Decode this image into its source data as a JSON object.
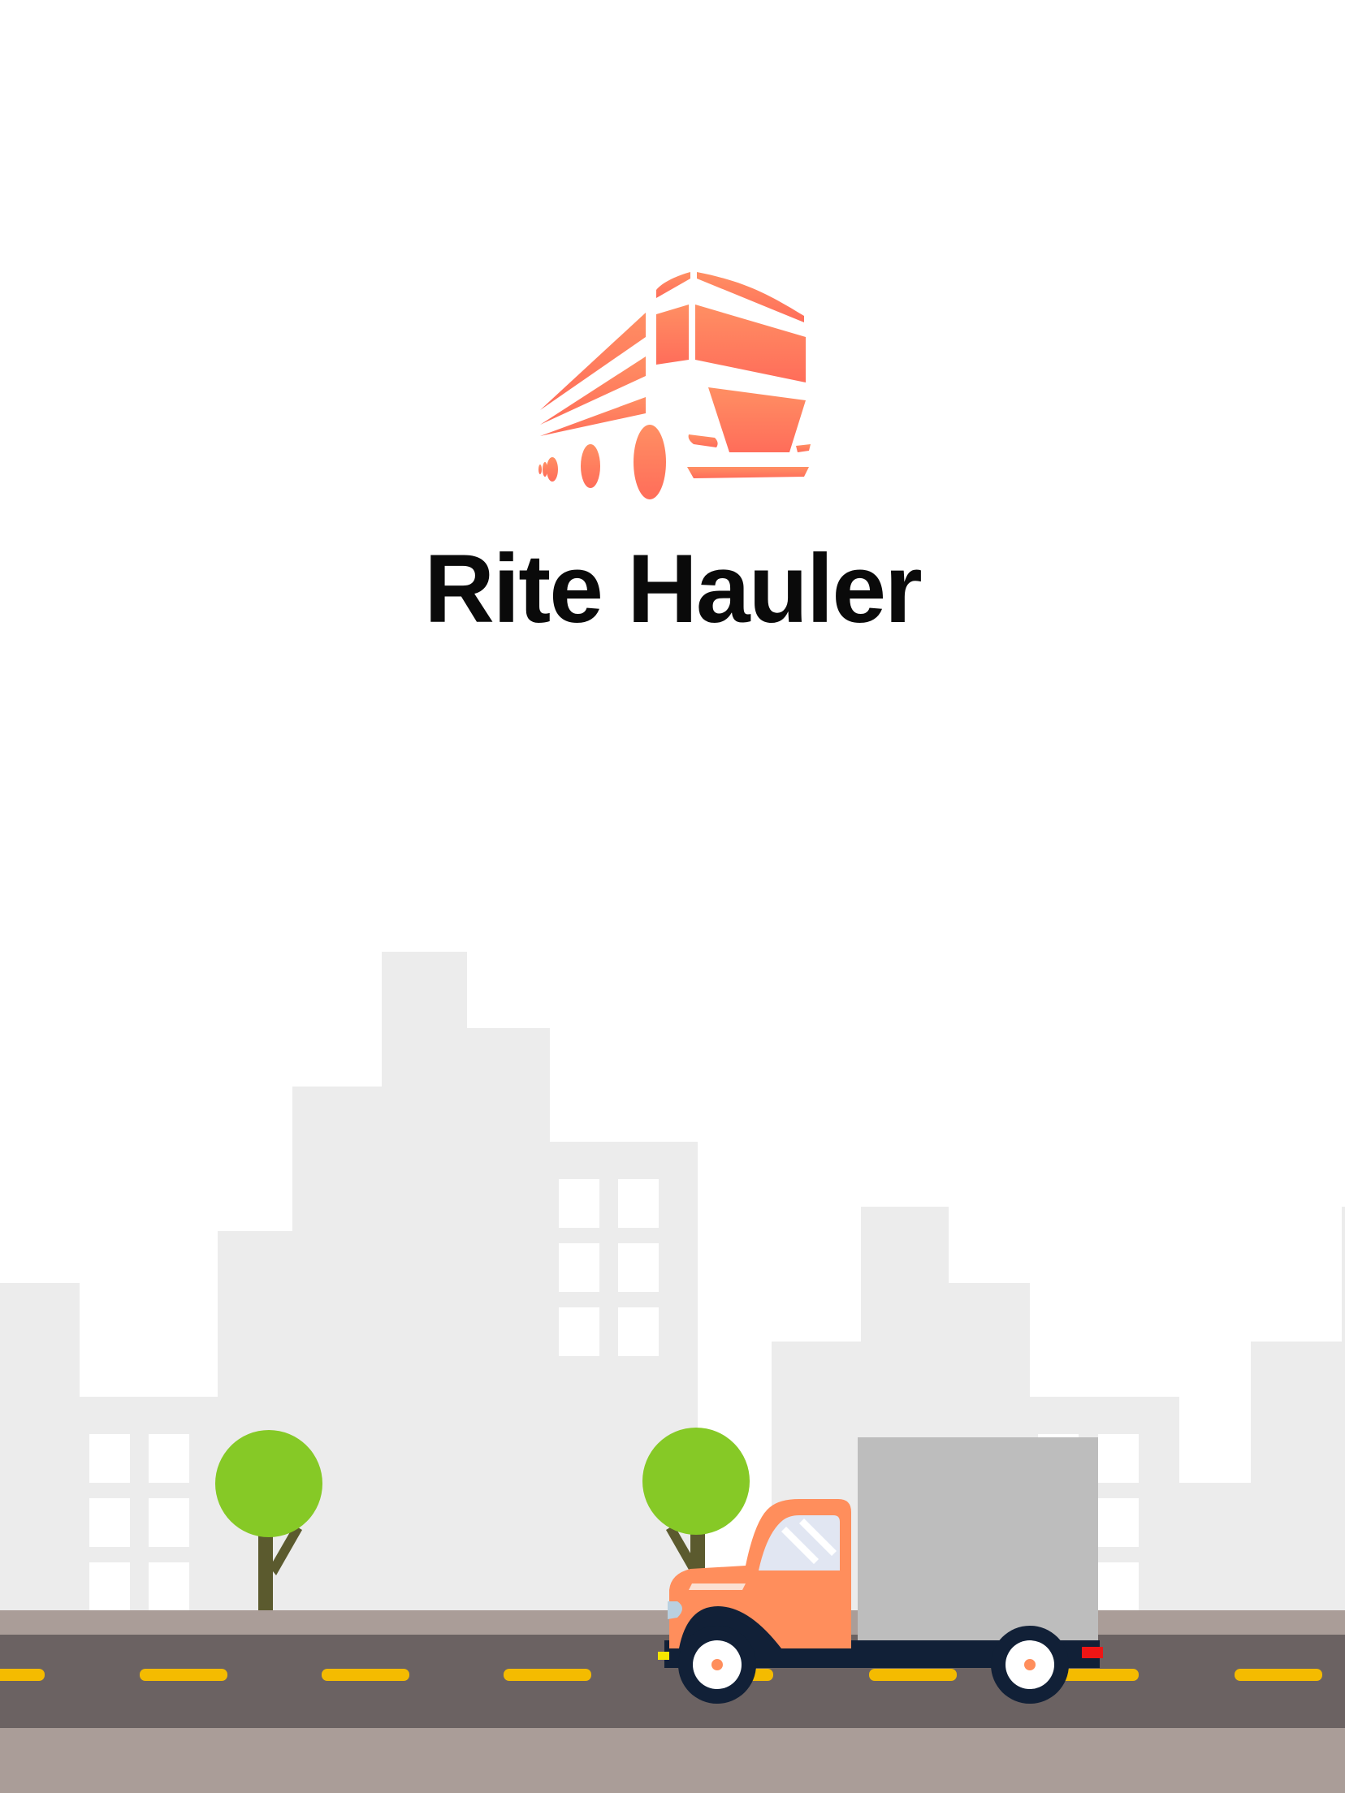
{
  "app": {
    "title": "Rite Hauler"
  },
  "logo": {
    "icon": "dump-truck-logo-icon",
    "color_top": "#ff8f63",
    "color_bottom": "#ff6d5a"
  },
  "scene": {
    "background_color": "#ffffff",
    "building_color": "#ececec",
    "window_color": "#ffffff",
    "tree_foliage_color": "#86c926",
    "tree_trunk_color": "#5b5a2e",
    "sidewalk_color": "#aa9d98",
    "road_color": "#6b6262",
    "lane_mark_color": "#f4bb00",
    "truck": {
      "icon": "delivery-truck-icon",
      "cab_color": "#ff8e5c",
      "cargo_color": "#bdbdbd",
      "chassis_color": "#112037",
      "window_color": "#e1e6f2"
    }
  }
}
